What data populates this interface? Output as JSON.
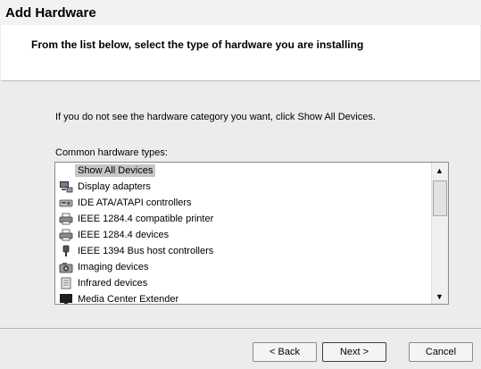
{
  "window": {
    "title": "Add Hardware"
  },
  "header": {
    "subtitle": "From the list below, select the type of hardware you are installing"
  },
  "body": {
    "info": "If you do not see the hardware category you want, click Show All Devices.",
    "list_label": "Common hardware types:"
  },
  "list": {
    "items": [
      {
        "label": "Show All Devices",
        "icon": "none",
        "selected": true
      },
      {
        "label": "Display adapters",
        "icon": "display-adapter-icon"
      },
      {
        "label": "IDE ATA/ATAPI controllers",
        "icon": "ide-controller-icon"
      },
      {
        "label": "IEEE 1284.4 compatible printer",
        "icon": "printer-icon"
      },
      {
        "label": "IEEE 1284.4 devices",
        "icon": "printer-icon"
      },
      {
        "label": "IEEE 1394 Bus host controllers",
        "icon": "ieee-1394-icon"
      },
      {
        "label": "Imaging devices",
        "icon": "camera-icon"
      },
      {
        "label": "Infrared devices",
        "icon": "infrared-icon"
      },
      {
        "label": "Media Center Extender",
        "icon": "monitor-icon"
      }
    ]
  },
  "buttons": {
    "back": "< Back",
    "next": "Next >",
    "cancel": "Cancel"
  }
}
